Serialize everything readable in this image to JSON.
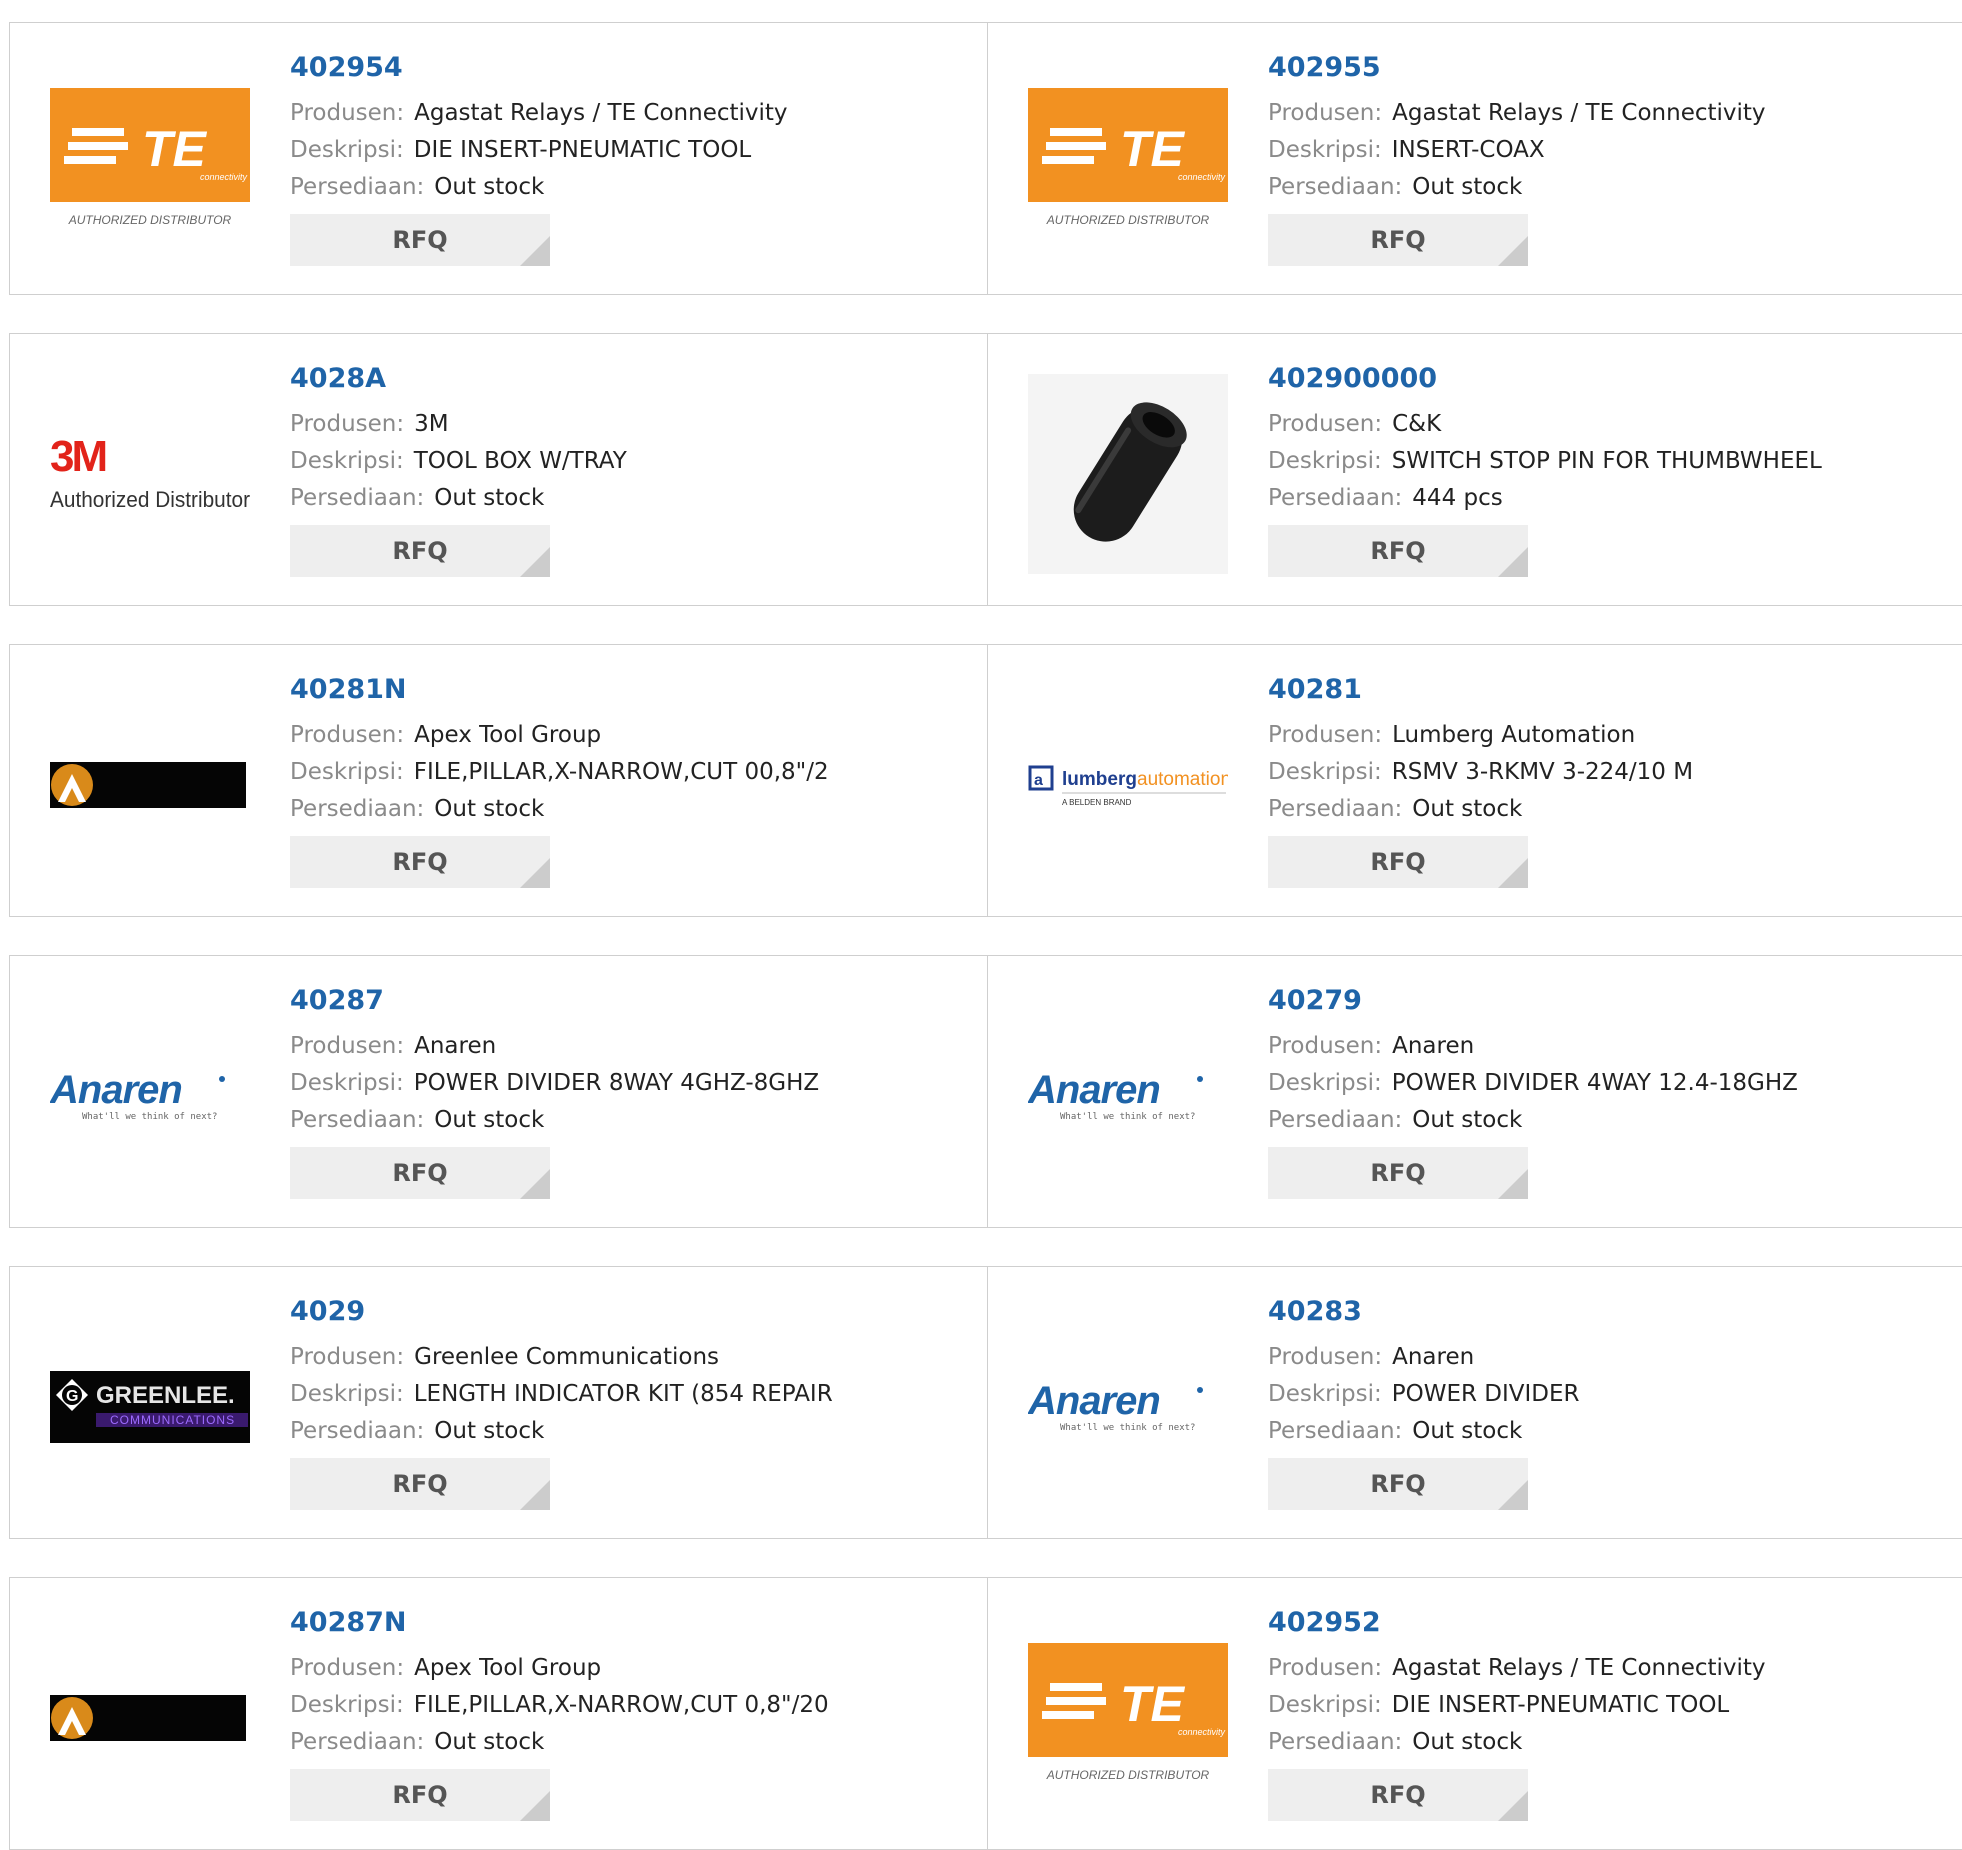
{
  "labels": {
    "manufacturer": "Produsen:",
    "description": "Deskripsi:",
    "stock": "Persediaan:",
    "rfq": "RFQ"
  },
  "logos": {
    "te_text": "TE",
    "te_sub": "connectivity",
    "te_footer": "AUTHORIZED DISTRIBUTOR",
    "mmm_text": "3M",
    "mmm_footer": "Authorized Distributor",
    "anaren_text": "Anaren",
    "anaren_tag": "What'll we think of next?",
    "lumberg_a": "lumberg",
    "lumberg_b": "automation",
    "lumberg_sub": "A BELDEN BRAND",
    "greenlee_text": "GREENLEE.",
    "greenlee_sub": "COMMUNICATIONS",
    "colors": {
      "te_orange": "#f29121",
      "link_blue": "#1f64a8",
      "anaren_blue": "#1f64a8",
      "lumberg_orange": "#f29121",
      "greenlee_purple": "#6a2ea8"
    }
  },
  "products": [
    {
      "part": "402954",
      "logo": "te",
      "manufacturer": "Agastat Relays / TE Connectivity",
      "description": "DIE INSERT-PNEUMATIC TOOL",
      "stock": "Out stock"
    },
    {
      "part": "402955",
      "logo": "te",
      "manufacturer": "Agastat Relays / TE Connectivity",
      "description": "INSERT-COAX",
      "stock": "Out stock"
    },
    {
      "part": "4028A",
      "logo": "3m",
      "manufacturer": "3M",
      "description": "TOOL BOX W/TRAY",
      "stock": "Out stock"
    },
    {
      "part": "402900000",
      "logo": "photo-pin",
      "manufacturer": "C&K",
      "description": "SWITCH STOP PIN FOR THUMBWHEEL",
      "stock": "444 pcs"
    },
    {
      "part": "40281N",
      "logo": "apex",
      "manufacturer": "Apex Tool Group",
      "description": "FILE,PILLAR,X-NARROW,CUT 00,8\"/2",
      "stock": "Out stock"
    },
    {
      "part": "40281",
      "logo": "lumberg",
      "manufacturer": "Lumberg Automation",
      "description": "RSMV 3-RKMV 3-224/10 M",
      "stock": "Out stock"
    },
    {
      "part": "40287",
      "logo": "anaren",
      "manufacturer": "Anaren",
      "description": "POWER DIVIDER 8WAY 4GHZ-8GHZ",
      "stock": "Out stock"
    },
    {
      "part": "40279",
      "logo": "anaren",
      "manufacturer": "Anaren",
      "description": "POWER DIVIDER 4WAY 12.4-18GHZ",
      "stock": "Out stock"
    },
    {
      "part": "4029",
      "logo": "greenlee",
      "manufacturer": "Greenlee Communications",
      "description": "LENGTH INDICATOR KIT (854 REPAIR",
      "stock": "Out stock"
    },
    {
      "part": "40283",
      "logo": "anaren",
      "manufacturer": "Anaren",
      "description": "POWER DIVIDER",
      "stock": "Out stock"
    },
    {
      "part": "40287N",
      "logo": "apex",
      "manufacturer": "Apex Tool Group",
      "description": "FILE,PILLAR,X-NARROW,CUT 0,8\"/20",
      "stock": "Out stock"
    },
    {
      "part": "402952",
      "logo": "te",
      "manufacturer": "Agastat Relays / TE Connectivity",
      "description": "DIE INSERT-PNEUMATIC TOOL",
      "stock": "Out stock"
    }
  ]
}
